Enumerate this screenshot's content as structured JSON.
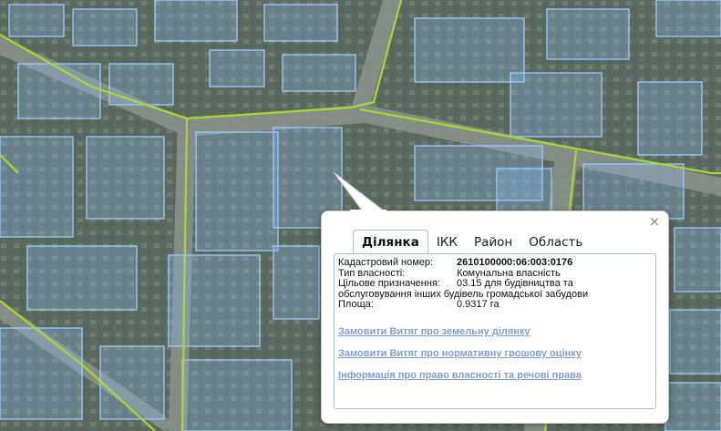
{
  "map": {
    "parcel_outline_color": "#9ecbff",
    "parcel_fill_color": "#8ec2ff",
    "boundary_line_color": "#a6d63a",
    "base_color": "#4a5a4c"
  },
  "popup": {
    "tabs": [
      "Ділянка",
      "ІКК",
      "Район",
      "Область"
    ],
    "active_tab": "Ділянка",
    "close_label": "×",
    "fields": {
      "cadastral_label": "Кадастровий номер:",
      "cadastral_value": "2610100000:06:003:0176",
      "ownership_label": "Тип власності:",
      "ownership_value": "Комунальна власність",
      "purpose_label": "Цільове призначення:",
      "purpose_value": "03.15 для будівництва та",
      "purpose_continuation": "обслуговування інших будівель громадської забудови",
      "area_label": "Площа:",
      "area_value": "0.9317 га"
    },
    "links": {
      "order_extract_land": "Замовити Витяг про земельну ділянку",
      "order_extract_valuation": "Замовити Витяг про нормативну грошову оцінку",
      "ownership_info": "Інформація про право власності та речові права"
    }
  }
}
